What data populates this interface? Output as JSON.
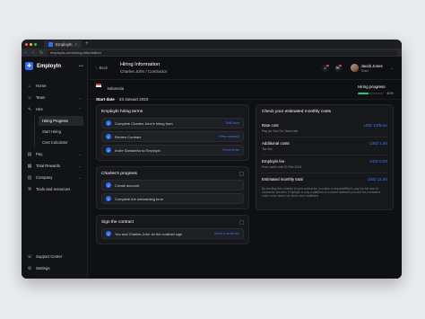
{
  "browser": {
    "tab_title": "Employln",
    "new_tab": "+",
    "url": "employln.com/hiring-information"
  },
  "sidebar": {
    "brand": "Employln",
    "brand_more": "•••",
    "items": [
      {
        "label": "Home",
        "icon": "home-icon"
      },
      {
        "label": "Team",
        "icon": "team-icon"
      },
      {
        "label": "Hire",
        "icon": "hire-icon"
      }
    ],
    "hire_sub": [
      "Hiring Progress",
      "Start Hiring",
      "Cost Calculator"
    ],
    "items2": [
      {
        "label": "Pay",
        "icon": "pay-icon"
      },
      {
        "label": "Total Rewards",
        "icon": "rewards-icon"
      },
      {
        "label": "Company",
        "icon": "company-icon"
      },
      {
        "label": "Tools and resources",
        "icon": "tools-icon"
      }
    ],
    "bottom": [
      {
        "label": "Support Center",
        "icon": "support-icon"
      },
      {
        "label": "Settings",
        "icon": "settings-icon"
      }
    ]
  },
  "header": {
    "back": "Back",
    "title": "Hiring Information",
    "subtitle": "Charles John / Contractor",
    "user_name": "Jacob Jones",
    "user_role": "Team"
  },
  "meta": {
    "country": "Indonesia",
    "start_label": "Start date",
    "start_value": "23 Januari 2023",
    "progress_label": "Hiring progress",
    "progress_value": 0.4,
    "progress_text": "40%"
  },
  "terms": {
    "title": "Employln hiring terms",
    "tasks": [
      {
        "text": "Complete Charles John’s hiring form",
        "link": "Edit form"
      },
      {
        "text": "Review Contract",
        "link": "View contract"
      },
      {
        "text": "Invite Samantha to Employln",
        "link": "Send invite"
      }
    ]
  },
  "progress_card": {
    "title": "Charles’s progress",
    "tasks": [
      {
        "text": "Create account"
      },
      {
        "text": "Complete the onboarding form"
      }
    ]
  },
  "sign_card": {
    "title": "Sign the contract",
    "tasks": [
      {
        "text": "You and Charles John do the contract sign",
        "link": "Send a reminder"
      }
    ]
  },
  "costs": {
    "title": "Check your estimated monthly costs",
    "rows": [
      {
        "name": "Rate cost",
        "sub": "Pay as You Go: fixed rate",
        "value": "USD 10/hour"
      },
      {
        "name": "Additional costs",
        "sub": "Tax fee",
        "value": "USD 1.00"
      },
      {
        "name": "Employln fee",
        "sub": "Free valid until 23 Feb 2024",
        "value": "USD 0.00"
      },
      {
        "name": "Estimated monthly total",
        "sub": "",
        "value": "USD 11.00"
      }
    ],
    "disclaimer": "By sending this contract to your contractor, you take a responsibility to pay the full cost of contractor services. Employln is only a platform to connect between you and the contractor. Learn more about our terms and conditions"
  },
  "colors": {
    "accent": "#2e6ff2",
    "success": "#27c47a",
    "bg": "#0f1013"
  }
}
